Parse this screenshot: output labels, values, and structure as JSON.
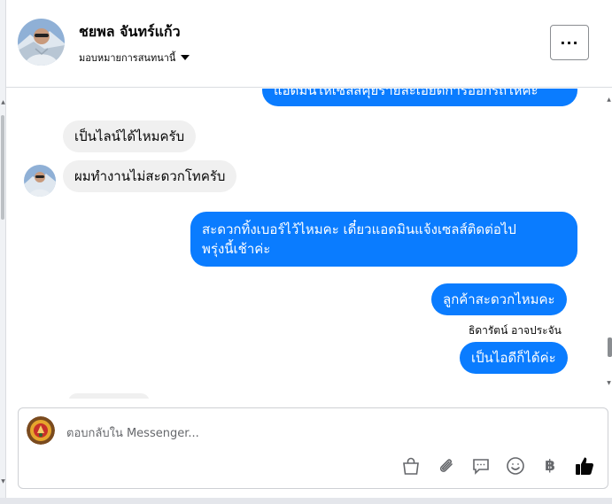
{
  "header": {
    "contact_name": "ชยพล จันทร์แก้ว",
    "assign_label": "มอบหมายการสนทนานี้",
    "more_label": "···"
  },
  "messages": [
    {
      "id": "m0",
      "direction": "outgoing",
      "text": "แอดมินให้เซลส์คุยรายละเอียดการออกรถให้คะ"
    },
    {
      "id": "m1",
      "direction": "incoming",
      "text": "เป็นไลน์ได้ไหมครับ"
    },
    {
      "id": "m2",
      "direction": "incoming",
      "text": "ผมทำงานไม่สะดวกโทครับ"
    },
    {
      "id": "m3",
      "direction": "outgoing",
      "lines": [
        "สะดวกทิ้งเบอร์ไว้ไหมคะ เดี๋ยวแอดมินแจ้งเซลส์ติดต่อไป",
        "พรุ่งนี้เช้าค่ะ"
      ]
    },
    {
      "id": "m4",
      "direction": "outgoing",
      "text": "ลูกค้าสะดวกไหมคะ"
    },
    {
      "id": "m5",
      "direction": "outgoing",
      "text": "เป็นไอดีก็ได้ค่ะ"
    }
  ],
  "sender_label": "ธิดารัตน์ อาจประจัน",
  "composer": {
    "placeholder": "ตอบกลับใน Messenger..."
  },
  "toolbar": {
    "icons": [
      "bag-icon",
      "paperclip-icon",
      "chat-bubble-icon",
      "emoji-icon",
      "baht-icon",
      "thumbs-up-icon"
    ],
    "baht_symbol": "฿"
  },
  "colors": {
    "outgoing_bubble": "#0a7cff",
    "incoming_bubble": "#f0f0f0",
    "like_icon": "#050505"
  }
}
